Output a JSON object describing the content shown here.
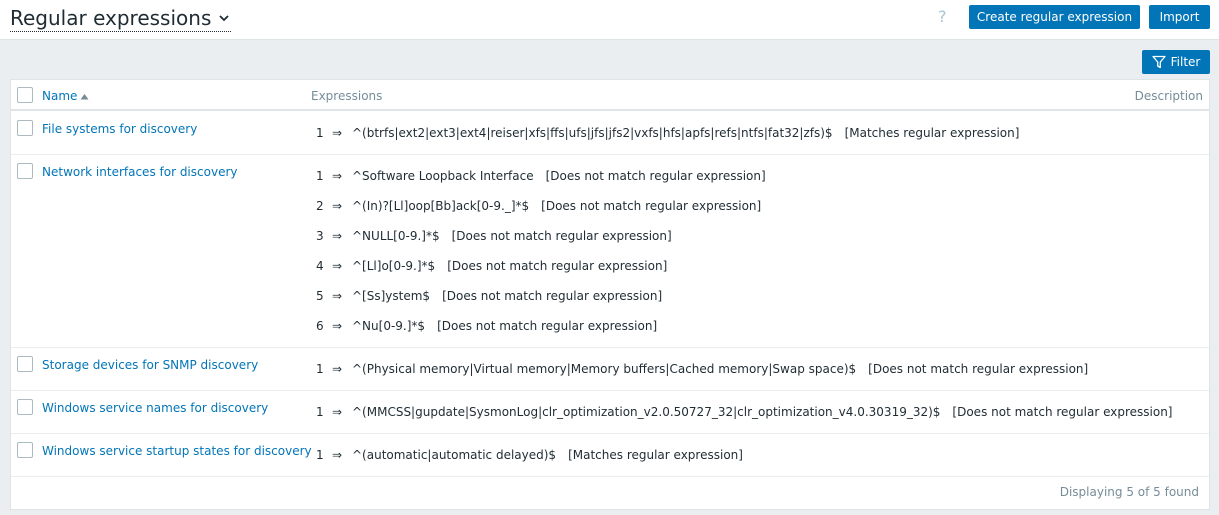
{
  "header": {
    "title": "Regular expressions",
    "help": "?",
    "create_label": "Create regular expression",
    "import_label": "Import"
  },
  "filter": {
    "label": "Filter"
  },
  "table": {
    "columns": {
      "name": "Name",
      "expressions": "Expressions",
      "description": "Description"
    },
    "arrow": "⇒",
    "rows": [
      {
        "name": "File systems for discovery",
        "expressions": [
          {
            "num": "1",
            "value": "^(btrfs|ext2|ext3|ext4|reiser|xfs|ffs|ufs|jfs|jfs2|vxfs|hfs|apfs|refs|ntfs|fat32|zfs)$",
            "type": "[Matches regular expression]"
          }
        ]
      },
      {
        "name": "Network interfaces for discovery",
        "expressions": [
          {
            "num": "1",
            "value": "^Software Loopback Interface",
            "type": "[Does not match regular expression]"
          },
          {
            "num": "2",
            "value": "^(In)?[Ll]oop[Bb]ack[0-9._]*$",
            "type": "[Does not match regular expression]"
          },
          {
            "num": "3",
            "value": "^NULL[0-9.]*$",
            "type": "[Does not match regular expression]"
          },
          {
            "num": "4",
            "value": "^[Ll]o[0-9.]*$",
            "type": "[Does not match regular expression]"
          },
          {
            "num": "5",
            "value": "^[Ss]ystem$",
            "type": "[Does not match regular expression]"
          },
          {
            "num": "6",
            "value": "^Nu[0-9.]*$",
            "type": "[Does not match regular expression]"
          }
        ]
      },
      {
        "name": "Storage devices for SNMP discovery",
        "expressions": [
          {
            "num": "1",
            "value": "^(Physical memory|Virtual memory|Memory buffers|Cached memory|Swap space)$",
            "type": "[Does not match regular expression]"
          }
        ]
      },
      {
        "name": "Windows service names for discovery",
        "expressions": [
          {
            "num": "1",
            "value": "^(MMCSS|gupdate|SysmonLog|clr_optimization_v2.0.50727_32|clr_optimization_v4.0.30319_32)$",
            "type": "[Does not match regular expression]"
          }
        ]
      },
      {
        "name": "Windows service startup states for discovery",
        "expressions": [
          {
            "num": "1",
            "value": "^(automatic|automatic delayed)$",
            "type": "[Matches regular expression]"
          }
        ]
      }
    ]
  },
  "footer": {
    "status": "Displaying 5 of 5 found"
  }
}
